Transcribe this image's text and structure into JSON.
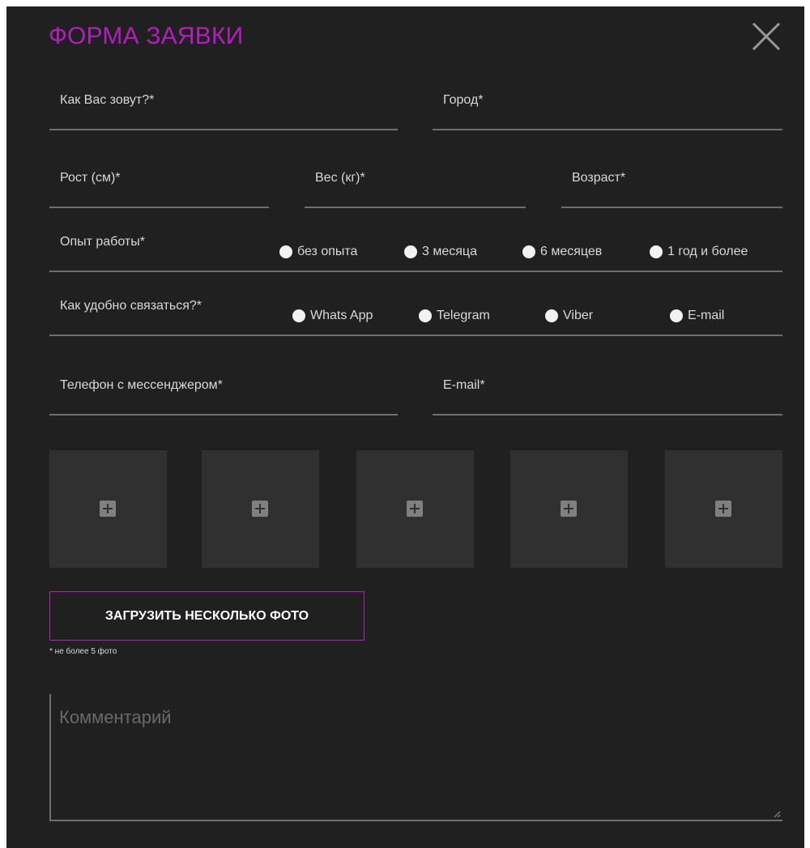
{
  "form": {
    "title": "ФОРМА ЗАЯВКИ",
    "accent_color": "#b41dbe",
    "close_icon": "close-icon",
    "fields": {
      "name": "Как Вас зовут?*",
      "city": "Город*",
      "height": "Рост (см)*",
      "weight": "Вес (кг)*",
      "age": "Возраст*",
      "phone": "Телефон с мессенджером*",
      "email": "E-mail*"
    },
    "experience": {
      "label": "Опыт работы*",
      "options": [
        "без опыта",
        "3 месяца",
        "6 месяцев",
        "1 год и более"
      ]
    },
    "contact": {
      "label": "Как удобно связаться?*",
      "options": [
        "Whats App",
        "Telegram",
        "Viber",
        "E-mail"
      ]
    },
    "photos": {
      "slot_icon": "plus-icon",
      "slots": 5,
      "upload_label": "ЗАГРУЗИТЬ НЕСКОЛЬКО ФОТО",
      "note": "* не более 5 фото"
    },
    "comment": {
      "placeholder": "Комментарий"
    }
  }
}
